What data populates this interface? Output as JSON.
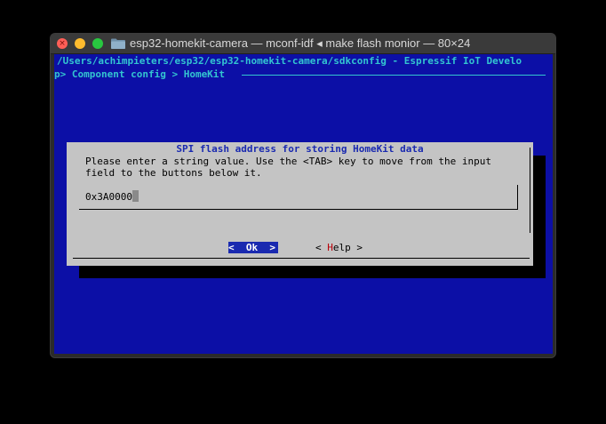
{
  "window": {
    "title": "esp32-homekit-camera — mconf-idf ◂ make flash monior — 80×24"
  },
  "terminal": {
    "path_line": "/Users/achimpieters/esp32/esp32-homekit-camera/sdkconfig - Espressif IoT Develo",
    "breadcrumb_line": "p> Component config > HomeKit"
  },
  "dialog": {
    "title": "SPI flash address for storing HomeKit data",
    "prompt": "Please enter a string value. Use the <TAB> key to move from the input\nfield to the buttons below it.",
    "input_value": "0x3A0000",
    "ok_left": "<  ",
    "ok_hot": "O",
    "ok_right": "k  >",
    "help_left": "< ",
    "help_hot": "H",
    "help_right": "elp >"
  },
  "colors": {
    "terminal_bg": "#0c0fa6",
    "header_text": "#33c5d0",
    "dialog_bg": "#c4c4c4",
    "dialog_title": "#1a2ab0",
    "hotkey": "#b8000a"
  },
  "icons": {
    "close": "close-icon",
    "minimize": "minimize-icon",
    "maximize": "maximize-icon",
    "folder": "folder-icon"
  }
}
